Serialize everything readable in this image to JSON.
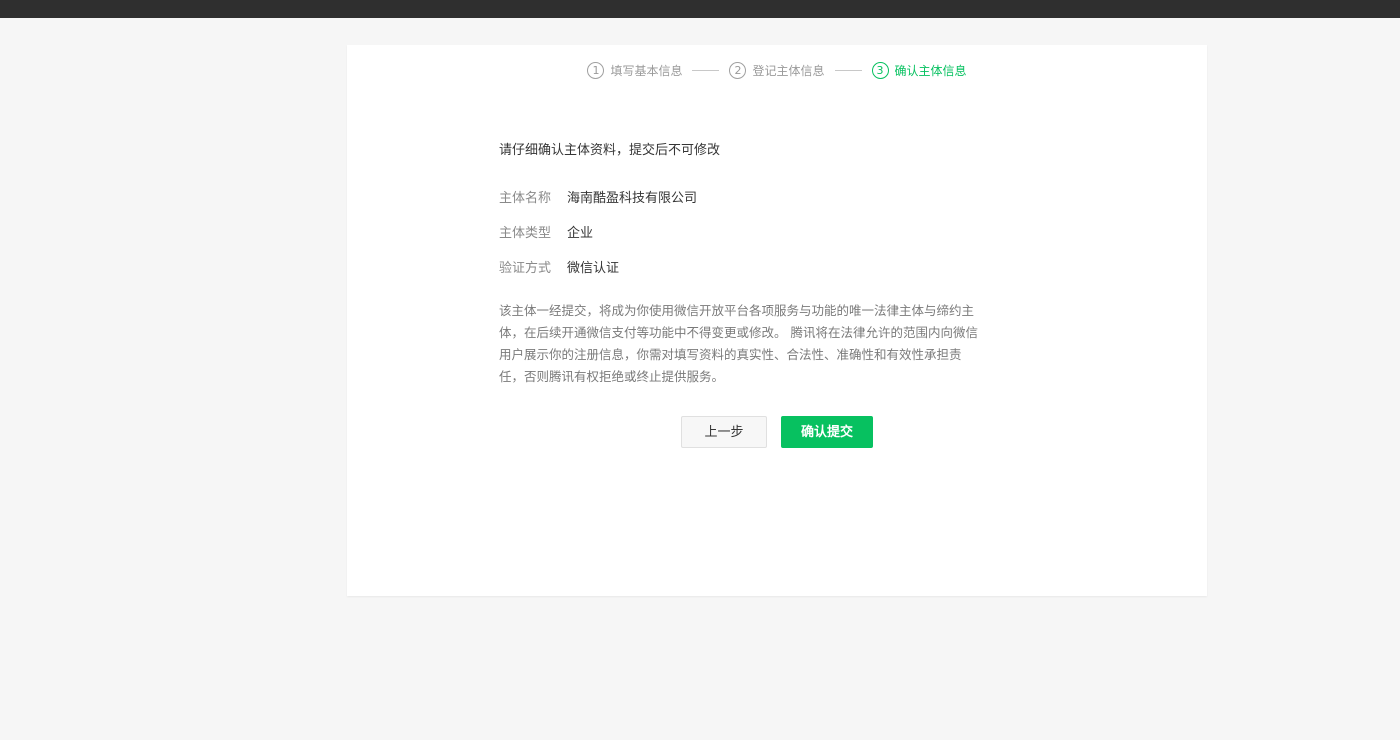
{
  "steps": [
    {
      "num": "1",
      "label": "填写基本信息",
      "active": false
    },
    {
      "num": "2",
      "label": "登记主体信息",
      "active": false
    },
    {
      "num": "3",
      "label": "确认主体信息",
      "active": true
    }
  ],
  "notice": "请仔细确认主体资料，提交后不可修改",
  "info": [
    {
      "label": "主体名称",
      "value": "海南酷盈科技有限公司"
    },
    {
      "label": "主体类型",
      "value": "企业"
    },
    {
      "label": "验证方式",
      "value": "微信认证"
    }
  ],
  "description": "该主体一经提交，将成为你使用微信开放平台各项服务与功能的唯一法律主体与缔约主体，在后续开通微信支付等功能中不得变更或修改。 腾讯将在法律允许的范围内向微信用户展示你的注册信息，你需对填写资料的真实性、合法性、准确性和有效性承担责任，否则腾讯有权拒绝或终止提供服务。",
  "buttons": {
    "prev_label": "上一步",
    "submit_label": "确认提交"
  },
  "colors": {
    "accent": "#07c160",
    "topbar": "#2f2f2f",
    "background": "#f6f6f6"
  }
}
